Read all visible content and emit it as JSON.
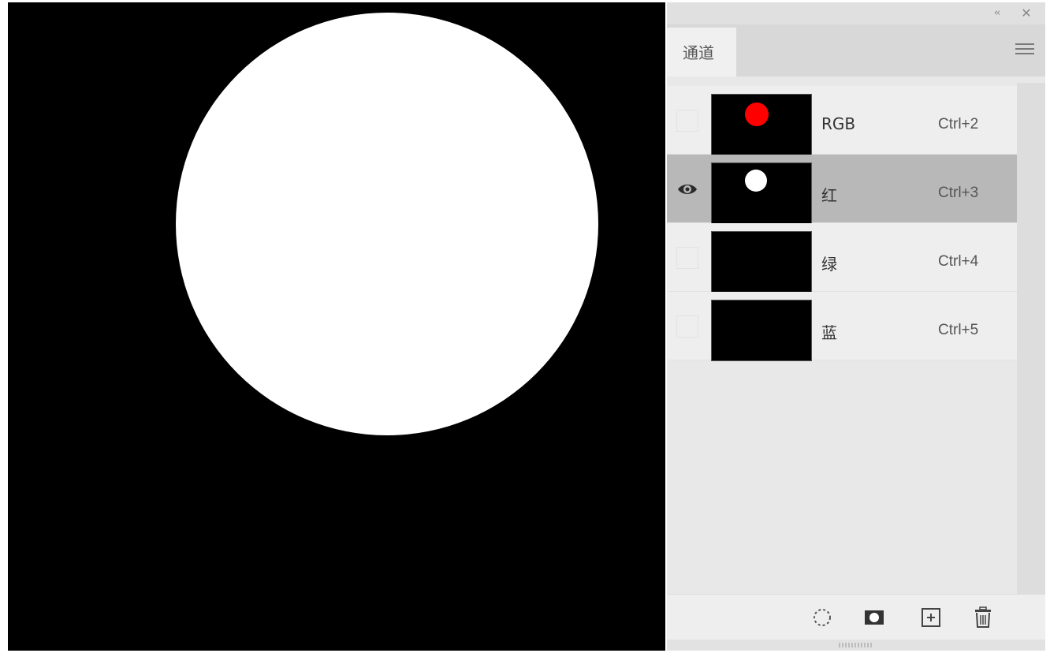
{
  "panel": {
    "tab_label": "通道",
    "collapse_glyph": "‹‹",
    "close_glyph": "✕"
  },
  "channels": [
    {
      "name": "RGB",
      "shortcut": "Ctrl+2",
      "visible": false,
      "selected": false,
      "thumb_dot_color": "#ff0000"
    },
    {
      "name": "红",
      "shortcut": "Ctrl+3",
      "visible": true,
      "selected": true,
      "thumb_dot_color": "#ffffff"
    },
    {
      "name": "绿",
      "shortcut": "Ctrl+4",
      "visible": false,
      "selected": false,
      "thumb_dot_color": ""
    },
    {
      "name": "蓝",
      "shortcut": "Ctrl+5",
      "visible": false,
      "selected": false,
      "thumb_dot_color": ""
    }
  ],
  "bottom_icons": [
    "load-selection-icon",
    "save-selection-icon",
    "new-channel-icon",
    "delete-channel-icon"
  ],
  "colors": {
    "canvas_bg": "#000000",
    "canvas_circle": "#ffffff",
    "selected_row": "#b8b8b8"
  }
}
